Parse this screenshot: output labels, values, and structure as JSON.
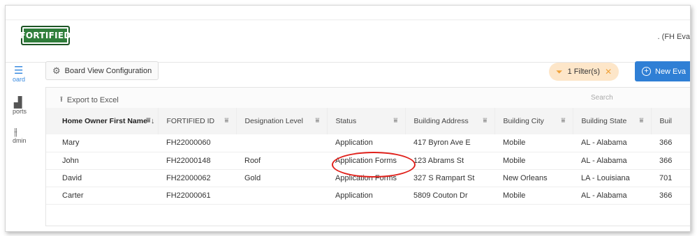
{
  "header": {
    "logo_text": "FORTIFIED",
    "user_text": ". (FH Eva"
  },
  "sidebar": {
    "items": [
      {
        "label": "oard",
        "icon": "list-icon"
      },
      {
        "label": "ports",
        "icon": "reports-icon"
      },
      {
        "label": "dmin",
        "icon": "admin-sliders-icon"
      }
    ]
  },
  "toolbar": {
    "board_view_label": "Board View Configuration",
    "filter_label": "1 Filter(s)",
    "new_button_label": "New Eva"
  },
  "grid": {
    "export_label": "Export to Excel",
    "search_placeholder": "Search",
    "columns": [
      "Home Owner First Name",
      "FORTIFIED ID",
      "Designation Level",
      "Status",
      "Building Address",
      "Building City",
      "Building State",
      "Buil"
    ],
    "rows": [
      [
        "Mary",
        "FH22000060",
        "",
        "Application",
        "417 Byron Ave E",
        "Mobile",
        "AL - Alabama",
        "366"
      ],
      [
        "John",
        "FH22000148",
        "Roof",
        "Application Forms",
        "123 Abrams St",
        "Mobile",
        "AL - Alabama",
        "366"
      ],
      [
        "David",
        "FH22000062",
        "Gold",
        "Application Forms",
        "327 S Rampart St",
        "New Orleans",
        "LA - Louisiana",
        "701"
      ],
      [
        "Carter",
        "FH22000061",
        "",
        "Application",
        "5809 Couton Dr",
        "Mobile",
        "AL - Alabama",
        "366"
      ]
    ]
  },
  "colors": {
    "brand_green": "#2f7d3a",
    "primary_blue": "#2f7fd5",
    "filter_bg": "#fde6c9",
    "annotation_red": "#e0201a"
  }
}
